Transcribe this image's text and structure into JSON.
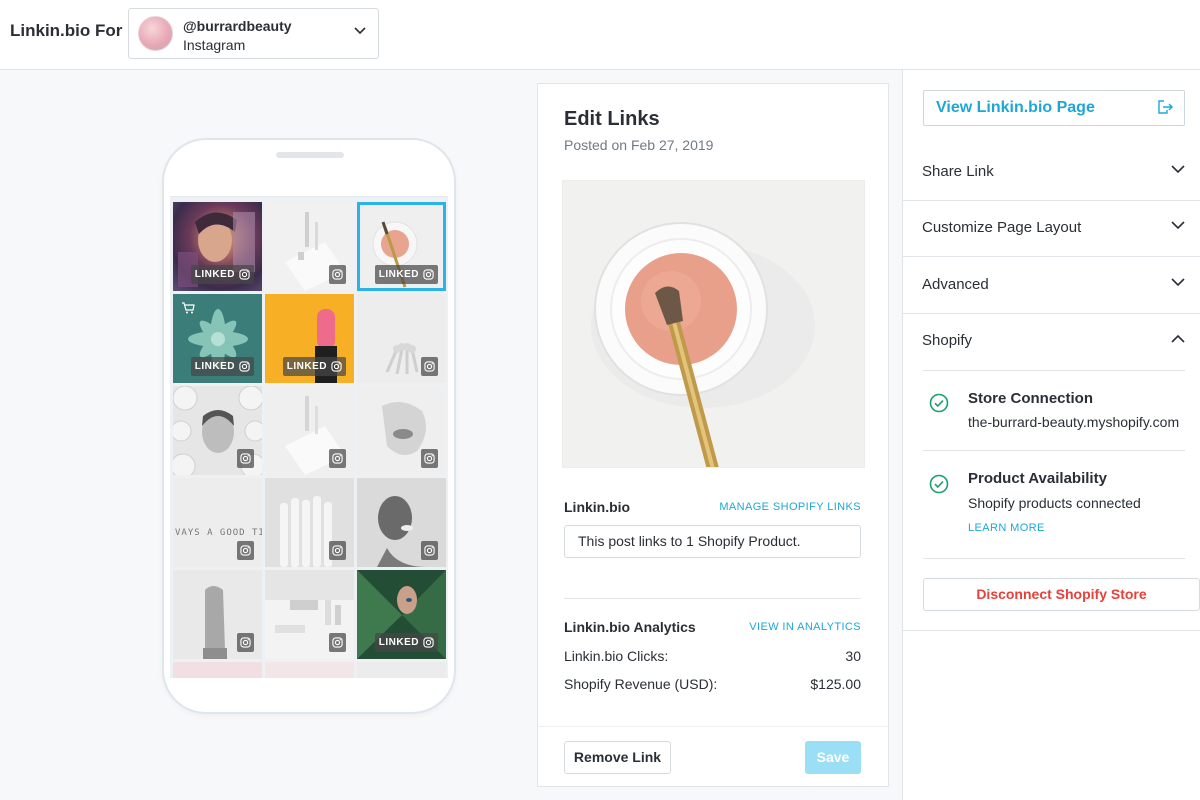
{
  "header": {
    "brand": "Linkin.bio For",
    "account": {
      "handle": "@burrardbeauty",
      "network": "Instagram"
    }
  },
  "grid": {
    "tiles": [
      {
        "badge": "LINKED",
        "selected": false
      },
      {
        "badge": "",
        "selected": false
      },
      {
        "badge": "LINKED",
        "selected": true
      },
      {
        "badge": "LINKED",
        "selected": false,
        "cart": true
      },
      {
        "badge": "LINKED",
        "selected": false
      },
      {
        "badge": "",
        "selected": false
      },
      {
        "badge": "",
        "selected": false
      },
      {
        "badge": "",
        "selected": false
      },
      {
        "badge": "",
        "selected": false
      },
      {
        "badge": "",
        "selected": false,
        "text": "VAYS A GOOD TI"
      },
      {
        "badge": "",
        "selected": false
      },
      {
        "badge": "",
        "selected": false
      },
      {
        "badge": "",
        "selected": false
      },
      {
        "badge": "",
        "selected": false
      },
      {
        "badge": "LINKED",
        "selected": false
      }
    ]
  },
  "edit": {
    "title": "Edit Links",
    "posted": "Posted on Feb 27, 2019",
    "linkinbio_label": "Linkin.bio",
    "manage_link": "MANAGE SHOPIFY LINKS",
    "field_value": "This post links to 1 Shopify Product.",
    "analytics_label": "Linkin.bio Analytics",
    "analytics_link": "VIEW IN ANALYTICS",
    "clicks_label": "Linkin.bio Clicks:",
    "clicks_value": "30",
    "revenue_label": "Shopify Revenue (USD):",
    "revenue_value": "$125.00",
    "remove_label": "Remove Link",
    "save_label": "Save"
  },
  "sidebar": {
    "view_page": "View Linkin.bio Page",
    "sections": [
      "Share Link",
      "Customize Page Layout",
      "Advanced",
      "Shopify"
    ],
    "store_title": "Store Connection",
    "store_value": "the-burrard-beauty.myshopify.com",
    "product_title": "Product Availability",
    "product_value": "Shopify products connected",
    "learn_more": "LEARN MORE",
    "disconnect": "Disconnect Shopify Store"
  },
  "colors": {
    "accent": "#1ea7d6",
    "selected_outline": "#2bb3e8",
    "danger": "#e8403a",
    "success": "#1e9e6a",
    "save_disabled": "#9bdff7"
  }
}
